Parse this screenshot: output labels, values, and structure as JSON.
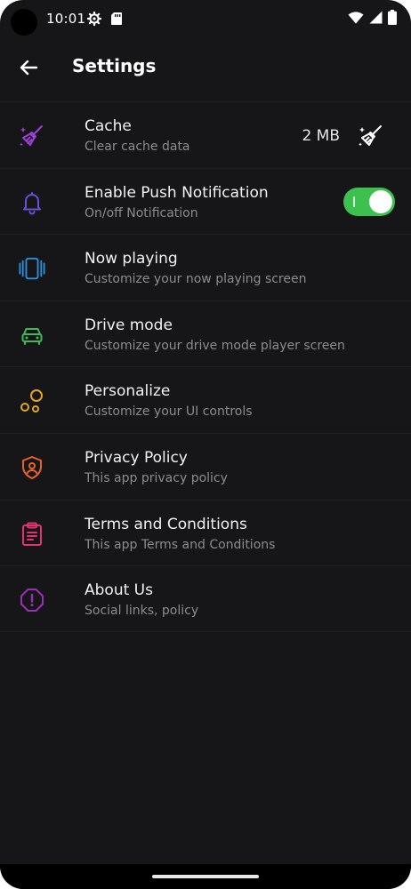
{
  "status_bar": {
    "time": "10:01"
  },
  "header": {
    "title": "Settings"
  },
  "settings": [
    {
      "id": "cache",
      "title": "Cache",
      "subtitle": "Clear cache data",
      "icon": "broom-icon",
      "color": "#9b3fd6",
      "value": "2 MB"
    },
    {
      "id": "push",
      "title": "Enable Push Notification",
      "subtitle": "On/off Notification",
      "icon": "bell-icon",
      "color": "#6b4fd8",
      "toggle_on": true
    },
    {
      "id": "now-playing",
      "title": "Now playing",
      "subtitle": "Customize your now playing screen",
      "icon": "carousel-icon",
      "color": "#2f8fd8"
    },
    {
      "id": "drive-mode",
      "title": "Drive mode",
      "subtitle": "Customize your drive mode player screen",
      "icon": "car-icon",
      "color": "#3fb95a"
    },
    {
      "id": "personalize",
      "title": "Personalize",
      "subtitle": "Customize your UI controls",
      "icon": "bubbles-icon",
      "color": "#e3a429"
    },
    {
      "id": "privacy",
      "title": "Privacy Policy",
      "subtitle": "This app privacy policy",
      "icon": "shield-icon",
      "color": "#e8622a"
    },
    {
      "id": "terms",
      "title": "Terms and Conditions",
      "subtitle": "This app Terms and Conditions",
      "icon": "clipboard-icon",
      "color": "#e2336f"
    },
    {
      "id": "about",
      "title": "About Us",
      "subtitle": "Social links, policy",
      "icon": "info-octagon-icon",
      "color": "#9a2fb8"
    }
  ],
  "colors": {
    "background": "#161618",
    "toggle_on": "#3cc14f",
    "subtitle": "#8c8c8f"
  }
}
